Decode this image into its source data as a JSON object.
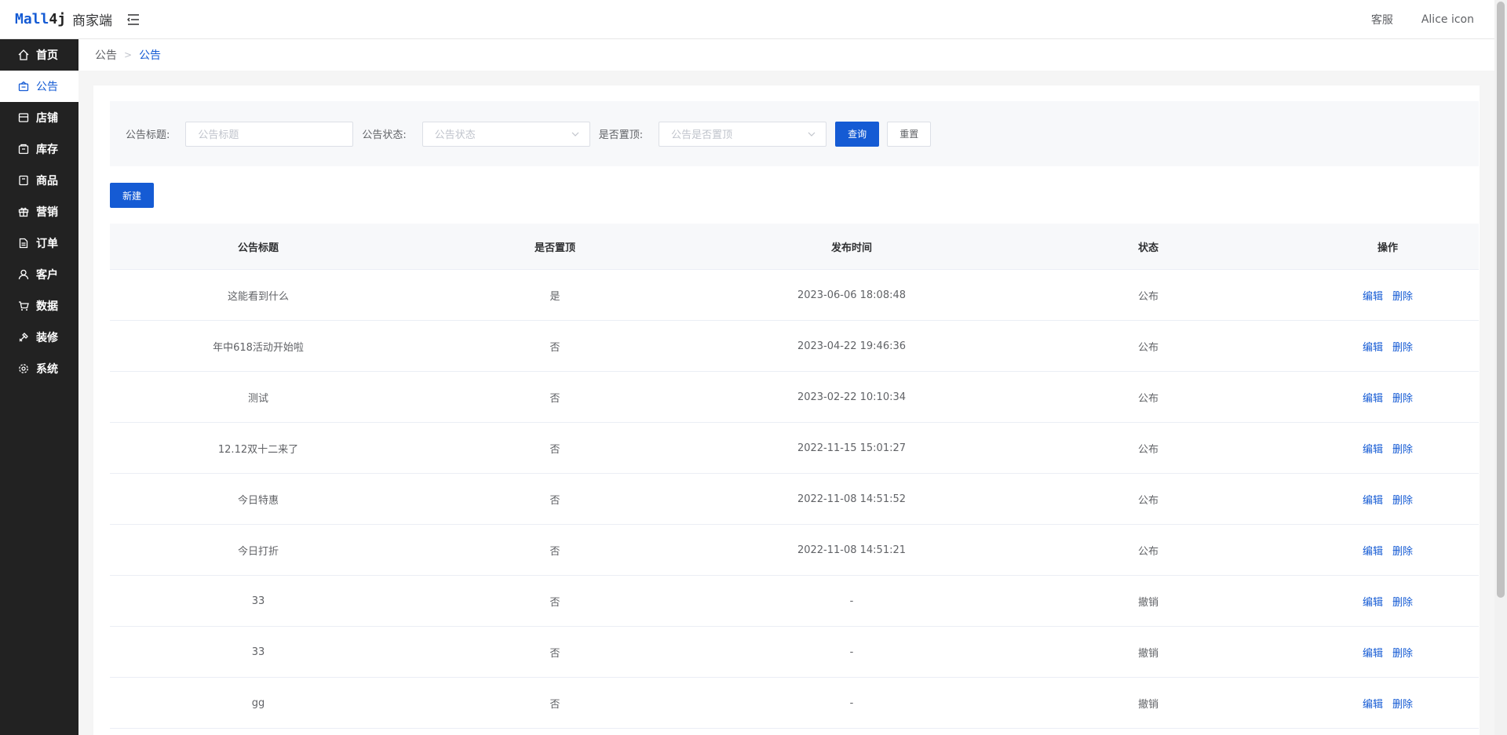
{
  "header": {
    "logo_brand_main": "Mall",
    "logo_brand_num": "4j",
    "logo_sub": "商家端",
    "service_label": "客服",
    "user_label": "Alice icon"
  },
  "sidebar": {
    "items": [
      {
        "label": "首页",
        "icon": "home-icon",
        "active": false
      },
      {
        "label": "公告",
        "icon": "notice-icon",
        "active": true
      },
      {
        "label": "店铺",
        "icon": "shop-icon",
        "active": false
      },
      {
        "label": "库存",
        "icon": "inventory-icon",
        "active": false
      },
      {
        "label": "商品",
        "icon": "product-icon",
        "active": false
      },
      {
        "label": "营销",
        "icon": "gift-icon",
        "active": false
      },
      {
        "label": "订单",
        "icon": "order-icon",
        "active": false
      },
      {
        "label": "客户",
        "icon": "user-icon",
        "active": false
      },
      {
        "label": "数据",
        "icon": "data-icon",
        "active": false
      },
      {
        "label": "装修",
        "icon": "decorate-icon",
        "active": false
      },
      {
        "label": "系统",
        "icon": "gear-icon",
        "active": false
      }
    ]
  },
  "breadcrumb": {
    "level1": "公告",
    "separator": ">",
    "level2": "公告"
  },
  "search": {
    "title_label": "公告标题:",
    "title_placeholder": "公告标题",
    "status_label": "公告状态:",
    "status_placeholder": "公告状态",
    "top_label": "是否置顶:",
    "top_placeholder": "公告是否置顶",
    "query_button": "查询",
    "reset_button": "重置"
  },
  "new_button": "新建",
  "table": {
    "headers": [
      "公告标题",
      "是否置顶",
      "发布时间",
      "状态",
      "操作"
    ],
    "edit_label": "编辑",
    "delete_label": "删除",
    "rows": [
      {
        "title": "这能看到什么",
        "top": "是",
        "time": "2023-06-06 18:08:48",
        "status": "公布"
      },
      {
        "title": "年中618活动开始啦",
        "top": "否",
        "time": "2023-04-22 19:46:36",
        "status": "公布"
      },
      {
        "title": "测试",
        "top": "否",
        "time": "2023-02-22 10:10:34",
        "status": "公布"
      },
      {
        "title": "12.12双十二来了",
        "top": "否",
        "time": "2022-11-15 15:01:27",
        "status": "公布"
      },
      {
        "title": "今日特惠",
        "top": "否",
        "time": "2022-11-08 14:51:52",
        "status": "公布"
      },
      {
        "title": "今日打折",
        "top": "否",
        "time": "2022-11-08 14:51:21",
        "status": "公布"
      },
      {
        "title": "33",
        "top": "否",
        "time": "-",
        "status": "撤销"
      },
      {
        "title": "33",
        "top": "否",
        "time": "-",
        "status": "撤销"
      },
      {
        "title": "gg",
        "top": "否",
        "time": "-",
        "status": "撤销"
      }
    ]
  },
  "colors": {
    "primary": "#155bd4",
    "sidebar_bg": "#222222",
    "page_bg": "#f5f5f5"
  }
}
